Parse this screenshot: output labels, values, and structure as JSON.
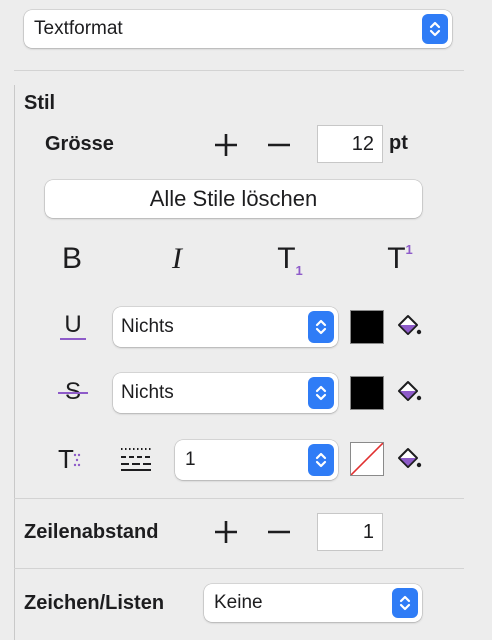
{
  "top_select": {
    "value": "Textformat"
  },
  "stil": {
    "heading": "Stil",
    "groesse": {
      "label": "Grösse",
      "value": "12",
      "unit": "pt"
    },
    "clear_button": "Alle Stile löschen",
    "format_buttons": {
      "bold": "B",
      "italic": "I",
      "subscript": "T",
      "subscript_index": "1",
      "superscript": "T",
      "superscript_index": "1"
    },
    "underline": {
      "icon_letter": "U",
      "value": "Nichts",
      "color": "#000000"
    },
    "strikethrough": {
      "icon_letter": "S",
      "value": "Nichts",
      "color": "#000000"
    },
    "outline": {
      "icon_letter": "T",
      "value": "1",
      "color": "none"
    }
  },
  "zeilenabstand": {
    "label": "Zeilenabstand",
    "value": "1"
  },
  "zeichen_listen": {
    "label": "Zeichen/Listen",
    "value": "Keine"
  },
  "colors": {
    "accent": "#2f7cf6",
    "purple": "#8e5bc9",
    "swatch": "#000000"
  }
}
